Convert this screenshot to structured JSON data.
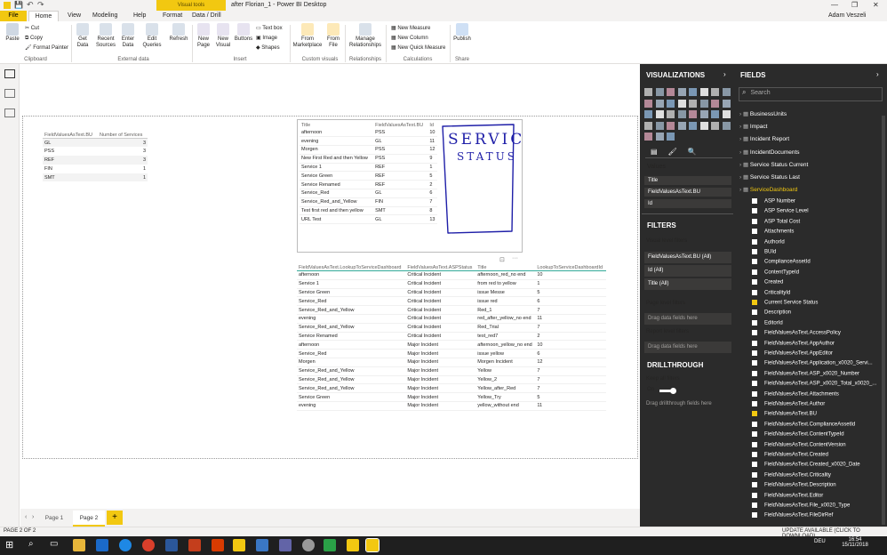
{
  "window": {
    "contextual_tab": "Visual tools",
    "title": "after Florian_1 - Power BI Desktop",
    "user": "Adam Veszeli"
  },
  "tabs": [
    "File",
    "Home",
    "View",
    "Modeling",
    "Help",
    "Format",
    "Data / Drill"
  ],
  "ribbon": {
    "clipboard": {
      "paste": "Paste",
      "cut": "Cut",
      "copy": "Copy",
      "format_painter": "Format Painter",
      "group": "Clipboard"
    },
    "external": {
      "get_data": "Get Data",
      "recent": "Recent Sources",
      "enter": "Enter Data",
      "edit": "Edit Queries",
      "refresh": "Refresh",
      "group": "External data"
    },
    "insert": {
      "new_page": "New Page",
      "new_visual": "New Visual",
      "buttons": "Buttons",
      "text_box": "Text box",
      "image": "Image",
      "shapes": "Shapes",
      "group": "Insert"
    },
    "custom": {
      "marketplace": "From Marketplace",
      "file": "From File",
      "group": "Custom visuals"
    },
    "relationships": {
      "manage": "Manage Relationships",
      "group": "Relationships"
    },
    "calculations": {
      "measure": "New Measure",
      "column": "New Column",
      "quick": "New Quick Measure",
      "group": "Calculations"
    },
    "share": {
      "publish": "Publish",
      "group": "Share"
    }
  },
  "table1": {
    "headers": [
      "FieldValuesAsText.BU",
      "Number of Services"
    ],
    "rows": [
      [
        "GL",
        "3"
      ],
      [
        "PSS",
        "3"
      ],
      [
        "REF",
        "3"
      ],
      [
        "FIN",
        "1"
      ],
      [
        "SMT",
        "1"
      ]
    ]
  },
  "table2": {
    "headers": [
      "Title",
      "FieldValuesAsText.BU",
      "Id"
    ],
    "rows": [
      [
        "afternoon",
        "PSS",
        "10"
      ],
      [
        "evening",
        "GL",
        "11"
      ],
      [
        "Morgen",
        "PSS",
        "12"
      ],
      [
        "New First Red and then Yellow",
        "PSS",
        "9"
      ],
      [
        "Service 1",
        "REF",
        "1"
      ],
      [
        "Service Green",
        "REF",
        "5"
      ],
      [
        "Service Renamed",
        "REF",
        "2"
      ],
      [
        "Service_Red",
        "GL",
        "6"
      ],
      [
        "Service_Red_and_Yellow",
        "FIN",
        "7"
      ],
      [
        "Test first red and then yellow",
        "SMT",
        "8"
      ],
      [
        "URL Test",
        "GL",
        "13"
      ]
    ]
  },
  "handwriting": {
    "line1": "SERVICE",
    "line2": "STATUS"
  },
  "table3": {
    "headers": [
      "FieldValuesAsText.LookupToServiceDashboard",
      "FieldValuesAsText.ASPStatus",
      "Title",
      "LookupToServiceDashboardId"
    ],
    "rows": [
      [
        "afternoon",
        "Critical Incident",
        "afternoon_red_no end",
        "10"
      ],
      [
        "Service 1",
        "Critical Incident",
        "from red to yellow",
        "1"
      ],
      [
        "Service Green",
        "Critical Incident",
        "issue Messe",
        "5"
      ],
      [
        "Service_Red",
        "Critical Incident",
        "issue red",
        "6"
      ],
      [
        "Service_Red_and_Yellow",
        "Critical Incident",
        "Red_1",
        "7"
      ],
      [
        "evening",
        "Critical Incident",
        "red_after_yellow_no end",
        "11"
      ],
      [
        "Service_Red_and_Yellow",
        "Critical Incident",
        "Red_Trial",
        "7"
      ],
      [
        "Service Renamed",
        "Critical Incident",
        "test_red7",
        "2"
      ],
      [
        "afternoon",
        "Major Incident",
        "afternoon_yellow_no end",
        "10"
      ],
      [
        "Service_Red",
        "Major Incident",
        "issue yellow",
        "6"
      ],
      [
        "Morgen",
        "Major Incident",
        "Morgen Incident",
        "12"
      ],
      [
        "Service_Red_and_Yellow",
        "Major Incident",
        "Yellow",
        "7"
      ],
      [
        "Service_Red_and_Yellow",
        "Major Incident",
        "Yellow_2",
        "7"
      ],
      [
        "Service_Red_and_Yellow",
        "Major Incident",
        "Yellow_after_Red",
        "7"
      ],
      [
        "Service Green",
        "Major Incident",
        "Yellow_Try",
        "5"
      ],
      [
        "evening",
        "Major Incident",
        "yellow_without end",
        "11"
      ]
    ]
  },
  "viz_panel": {
    "title": "VISUALIZATIONS",
    "values_label": "Values",
    "values": [
      "Title",
      "FieldValuesAsText.BU",
      "Id"
    ],
    "filters_title": "FILTERS",
    "visual_filters": "Visual level filters",
    "filter_items": [
      "FieldValuesAsText.BU (All)",
      "Id (All)",
      "Title (All)"
    ],
    "page_filters": "Page level filters",
    "drag_fields": "Drag data fields here",
    "report_filters": "Report level filters",
    "drag_fields2": "Drag data fields here",
    "drill_title": "DRILLTHROUGH",
    "keep_filters": "Keep all filters",
    "on": "On",
    "drag_drill": "Drag drillthrough fields here"
  },
  "fields_panel": {
    "title": "FIELDS",
    "search_placeholder": "Search",
    "tables": [
      "BusinessUnits",
      "Impact",
      "Incident Report",
      "IncidentDocuments",
      "Service Status Current",
      "Service Status Last",
      "ServiceDashboard"
    ],
    "fields": [
      "ASP Number",
      "ASP Service Level",
      "ASP Total Cost",
      "Attachments",
      "AuthorId",
      "BUId",
      "ComplianceAssetId",
      "ContentTypeId",
      "Created",
      "CriticalityId",
      "Current Service Status",
      "Description",
      "EditorId",
      "FieldValuesAsText.AccessPolicy",
      "FieldValuesAsText.AppAuthor",
      "FieldValuesAsText.AppEditor",
      "FieldValuesAsText.Application_x0020_Servi...",
      "FieldValuesAsText.ASP_x0020_Number",
      "FieldValuesAsText.ASP_x0020_Total_x0020_...",
      "FieldValuesAsText.Attachments",
      "FieldValuesAsText.Author",
      "FieldValuesAsText.BU",
      "FieldValuesAsText.ComplianceAssetId",
      "FieldValuesAsText.ContentTypeId",
      "FieldValuesAsText.ContentVersion",
      "FieldValuesAsText.Created",
      "FieldValuesAsText.Created_x0020_Date",
      "FieldValuesAsText.Criticality",
      "FieldValuesAsText.Description",
      "FieldValuesAsText.Editor",
      "FieldValuesAsText.File_x0020_Type",
      "FieldValuesAsText.FileDirRef"
    ]
  },
  "pages": {
    "p1": "Page 1",
    "p2": "Page 2",
    "add": "+"
  },
  "status": {
    "left": "PAGE 2 OF 2",
    "right": "UPDATE AVAILABLE (CLICK TO DOWNLOAD)"
  },
  "taskbar": {
    "lang": "DEU",
    "time": "16:54",
    "date": "15/11/2018"
  }
}
